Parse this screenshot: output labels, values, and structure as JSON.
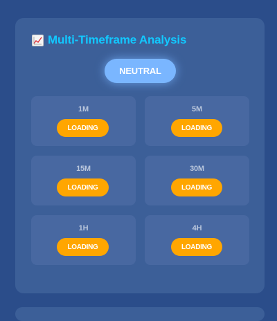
{
  "panel": {
    "title": "Multi-Timeframe Analysis",
    "title_icon": "chart-increasing-icon",
    "title_color": "#12c8ff",
    "overall_signal": "NEUTRAL",
    "signal_color": "#7ab6ff"
  },
  "timeframes": [
    {
      "label": "1M",
      "status": "LOADING"
    },
    {
      "label": "5M",
      "status": "LOADING"
    },
    {
      "label": "15M",
      "status": "LOADING"
    },
    {
      "label": "30M",
      "status": "LOADING"
    },
    {
      "label": "1H",
      "status": "LOADING"
    },
    {
      "label": "4H",
      "status": "LOADING"
    }
  ],
  "colors": {
    "background": "#2b4d8a",
    "panel": "#3c5f98",
    "card": "#4868a1",
    "loading_badge": "#ffa600"
  }
}
